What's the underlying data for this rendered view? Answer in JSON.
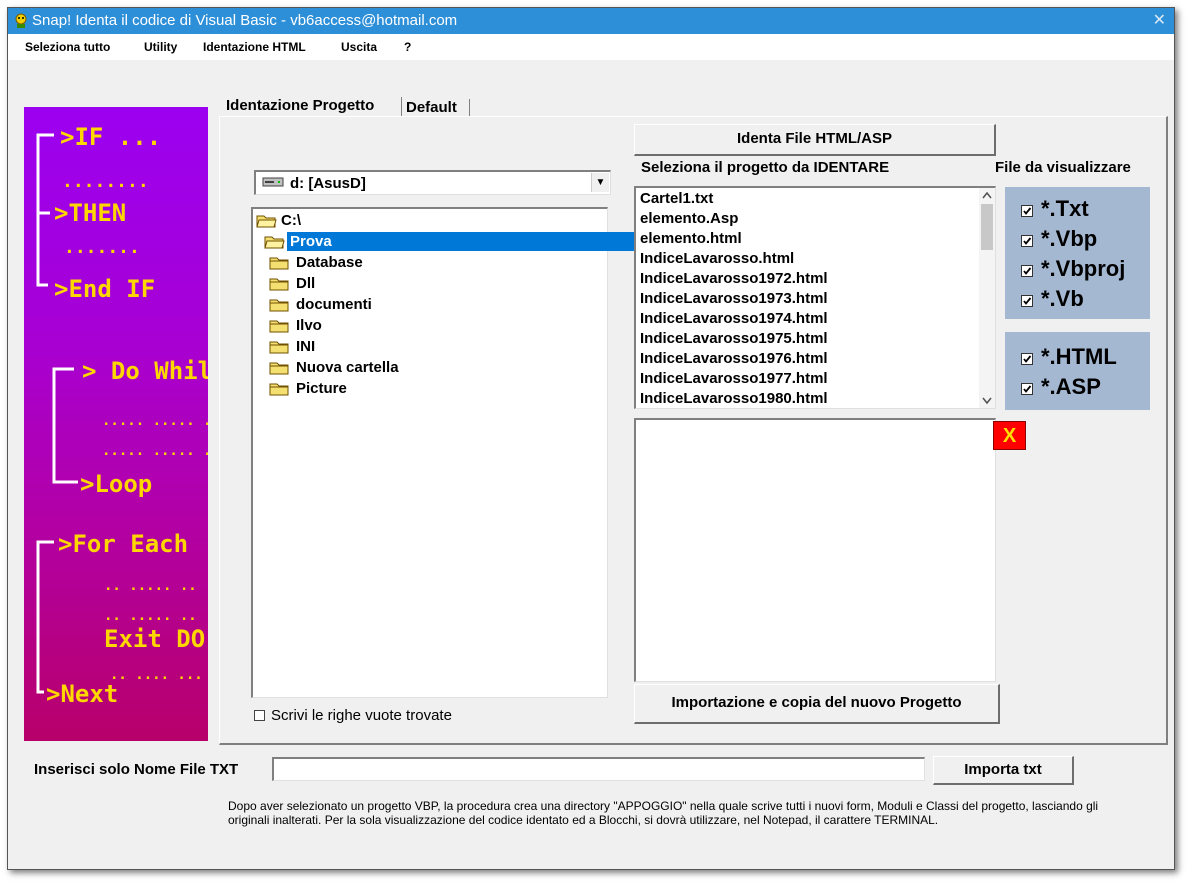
{
  "window": {
    "title": "Snap!  Identa il codice di Visual Basic  - vb6access@hotmail.com",
    "close_glyph": "✕"
  },
  "menu": {
    "items": [
      {
        "label": "Seleziona tutto"
      },
      {
        "label": "Utility"
      },
      {
        "label": "Identazione HTML"
      },
      {
        "label": "Uscita"
      },
      {
        "label": "?"
      }
    ]
  },
  "banner": {
    "lines": [
      ">IF ...",
      "........",
      ">THEN",
      ".......",
      ">End IF",
      "> Do While",
      "..... ..... ..",
      "..... ..... ..",
      ">Loop",
      ">For Each",
      ".. ..... ..",
      ".. ..... ..",
      "Exit DO",
      ".. .... ...",
      ">Next"
    ]
  },
  "tabs": {
    "active": "Identazione Progetto",
    "inactive": "Default"
  },
  "buttons": {
    "identa": "Identa File HTML/ASP",
    "importazione": "Importazione e copia del nuovo Progetto",
    "importa_txt": "Importa txt",
    "clear_x": "X"
  },
  "labels": {
    "seleziona_progetto": "Seleziona il progetto da IDENTARE",
    "file_da_visualizzare": "File da visualizzare",
    "nome_file": "Inserisci solo Nome File TXT",
    "scrivi_righe": "Scrivi le righe vuote trovate"
  },
  "drive": {
    "value": "d: [AsusD]",
    "arrow": "▼"
  },
  "tree": {
    "root": "C:\\",
    "open": "Prova",
    "folders": [
      "Database",
      "Dll",
      "documenti",
      "Ilvo",
      "INI",
      "Nuova cartella",
      "Picture"
    ]
  },
  "files": [
    "Cartel1.txt",
    "elemento.Asp",
    "elemento.html",
    "IndiceLavarosso.html",
    "IndiceLavarosso1972.html",
    "IndiceLavarosso1973.html",
    "IndiceLavarosso1974.html",
    "IndiceLavarosso1975.html",
    "IndiceLavarosso1976.html",
    "IndiceLavarosso1977.html",
    "IndiceLavarosso1980.html"
  ],
  "filters_group1": [
    {
      "label": "*.Txt",
      "checked": true
    },
    {
      "label": "*.Vbp",
      "checked": true
    },
    {
      "label": "*.Vbproj",
      "checked": true
    },
    {
      "label": "*.Vb",
      "checked": true
    }
  ],
  "filters_group2": [
    {
      "label": "*.HTML",
      "checked": true
    },
    {
      "label": "*.ASP",
      "checked": true
    }
  ],
  "checkbox_righe_checked": false,
  "nome_file_value": "",
  "note": "Dopo aver selezionato un progetto VBP, la procedura crea una directory \"APPOGGIO\" nella quale scrive tutti i nuovi form, Moduli e Classi del progetto, lasciando gli originali inalterati. Per la sola visualizzazione del codice identato ed a Blocchi, si dovrà utilizzare, nel Notepad, il carattere TERMINAL.",
  "colors": {
    "titlebar": "#2d8fd8",
    "banner_top": "#9b00f0",
    "banner_bottom": "#b8006a",
    "banner_text": "#ffd700",
    "selection": "#0078d7",
    "filter_box": "#a5b8d2",
    "clear_button": "#ff0000"
  }
}
